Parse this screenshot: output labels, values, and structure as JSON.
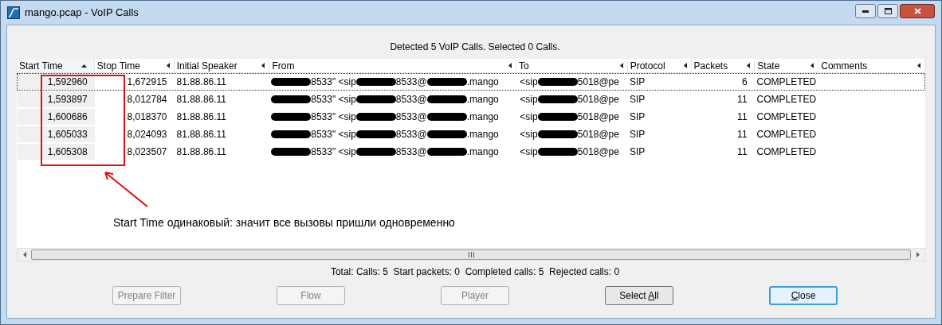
{
  "window": {
    "title": "mango.pcap - VoIP Calls"
  },
  "message": "Detected 5 VoIP Calls. Selected 0 Calls.",
  "table": {
    "columns": [
      {
        "label": "Start Time",
        "sorted": true
      },
      {
        "label": "Stop Time",
        "sorted": false
      },
      {
        "label": "Initial Speaker",
        "sorted": false
      },
      {
        "label": "From",
        "sorted": false
      },
      {
        "label": "To",
        "sorted": false
      },
      {
        "label": "Protocol",
        "sorted": false
      },
      {
        "label": "Packets",
        "sorted": false
      },
      {
        "label": "State",
        "sorted": false
      },
      {
        "label": "Comments",
        "sorted": false
      }
    ],
    "rows": [
      {
        "focused": true,
        "cells": [
          "1,592960",
          "1,672915",
          "81.88.86.11",
          [
            {
              "kind": "redacted"
            },
            {
              "kind": "text",
              "text": "8533\" <sip"
            },
            {
              "kind": "redacted"
            },
            {
              "kind": "text",
              "text": "8533@"
            },
            {
              "kind": "redacted"
            },
            {
              "kind": "text",
              "text": ".mango"
            }
          ],
          [
            {
              "kind": "text",
              "text": "<sip"
            },
            {
              "kind": "redacted"
            },
            {
              "kind": "text",
              "text": "5018@pe"
            }
          ],
          "SIP",
          "6",
          "COMPLETED",
          ""
        ]
      },
      {
        "focused": false,
        "cells": [
          "1,593897",
          "8,012784",
          "81.88.86.11",
          [
            {
              "kind": "redacted"
            },
            {
              "kind": "text",
              "text": "8533\" <sip"
            },
            {
              "kind": "redacted"
            },
            {
              "kind": "text",
              "text": "8533@"
            },
            {
              "kind": "redacted"
            },
            {
              "kind": "text",
              "text": ".mango"
            }
          ],
          [
            {
              "kind": "text",
              "text": "<sip"
            },
            {
              "kind": "redacted"
            },
            {
              "kind": "text",
              "text": "5018@pe"
            }
          ],
          "SIP",
          "11",
          "COMPLETED",
          ""
        ]
      },
      {
        "focused": false,
        "cells": [
          "1,600686",
          "8,018370",
          "81.88.86.11",
          [
            {
              "kind": "redacted"
            },
            {
              "kind": "text",
              "text": "8533\" <sip"
            },
            {
              "kind": "redacted"
            },
            {
              "kind": "text",
              "text": "8533@"
            },
            {
              "kind": "redacted"
            },
            {
              "kind": "text",
              "text": ".mango"
            }
          ],
          [
            {
              "kind": "text",
              "text": "<sip"
            },
            {
              "kind": "redacted"
            },
            {
              "kind": "text",
              "text": "5018@pe"
            }
          ],
          "SIP",
          "11",
          "COMPLETED",
          ""
        ]
      },
      {
        "focused": false,
        "cells": [
          "1,605033",
          "8,024093",
          "81.88.86.11",
          [
            {
              "kind": "redacted"
            },
            {
              "kind": "text",
              "text": "8533\" <sip"
            },
            {
              "kind": "redacted"
            },
            {
              "kind": "text",
              "text": "8533@"
            },
            {
              "kind": "redacted"
            },
            {
              "kind": "text",
              "text": ".mango"
            }
          ],
          [
            {
              "kind": "text",
              "text": "<sip"
            },
            {
              "kind": "redacted"
            },
            {
              "kind": "text",
              "text": "5018@pe"
            }
          ],
          "SIP",
          "11",
          "COMPLETED",
          ""
        ]
      },
      {
        "focused": false,
        "cells": [
          "1,605308",
          "8,023507",
          "81.88.86.11",
          [
            {
              "kind": "redacted"
            },
            {
              "kind": "text",
              "text": "8533\" <sip"
            },
            {
              "kind": "redacted"
            },
            {
              "kind": "text",
              "text": "8533@"
            },
            {
              "kind": "redacted"
            },
            {
              "kind": "text",
              "text": ".mango"
            }
          ],
          [
            {
              "kind": "text",
              "text": "<sip"
            },
            {
              "kind": "redacted"
            },
            {
              "kind": "text",
              "text": "5018@pe"
            }
          ],
          "SIP",
          "11",
          "COMPLETED",
          ""
        ]
      }
    ]
  },
  "annotation": {
    "text": "Start Time одинаковый: значит все вызовы пришли одновременно"
  },
  "totals": "Total: Calls: 5  Start packets: 0  Completed calls: 5  Rejected calls: 0",
  "buttons": [
    {
      "label": "Prepare Filter",
      "disabled": true,
      "default": false
    },
    {
      "label": "Flow",
      "disabled": true,
      "default": false
    },
    {
      "label": "Player",
      "disabled": true,
      "default": false
    },
    {
      "label": "Select **A**ll",
      "disabled": false,
      "default": false
    },
    {
      "label": "**C**lose",
      "disabled": false,
      "default": true
    }
  ]
}
